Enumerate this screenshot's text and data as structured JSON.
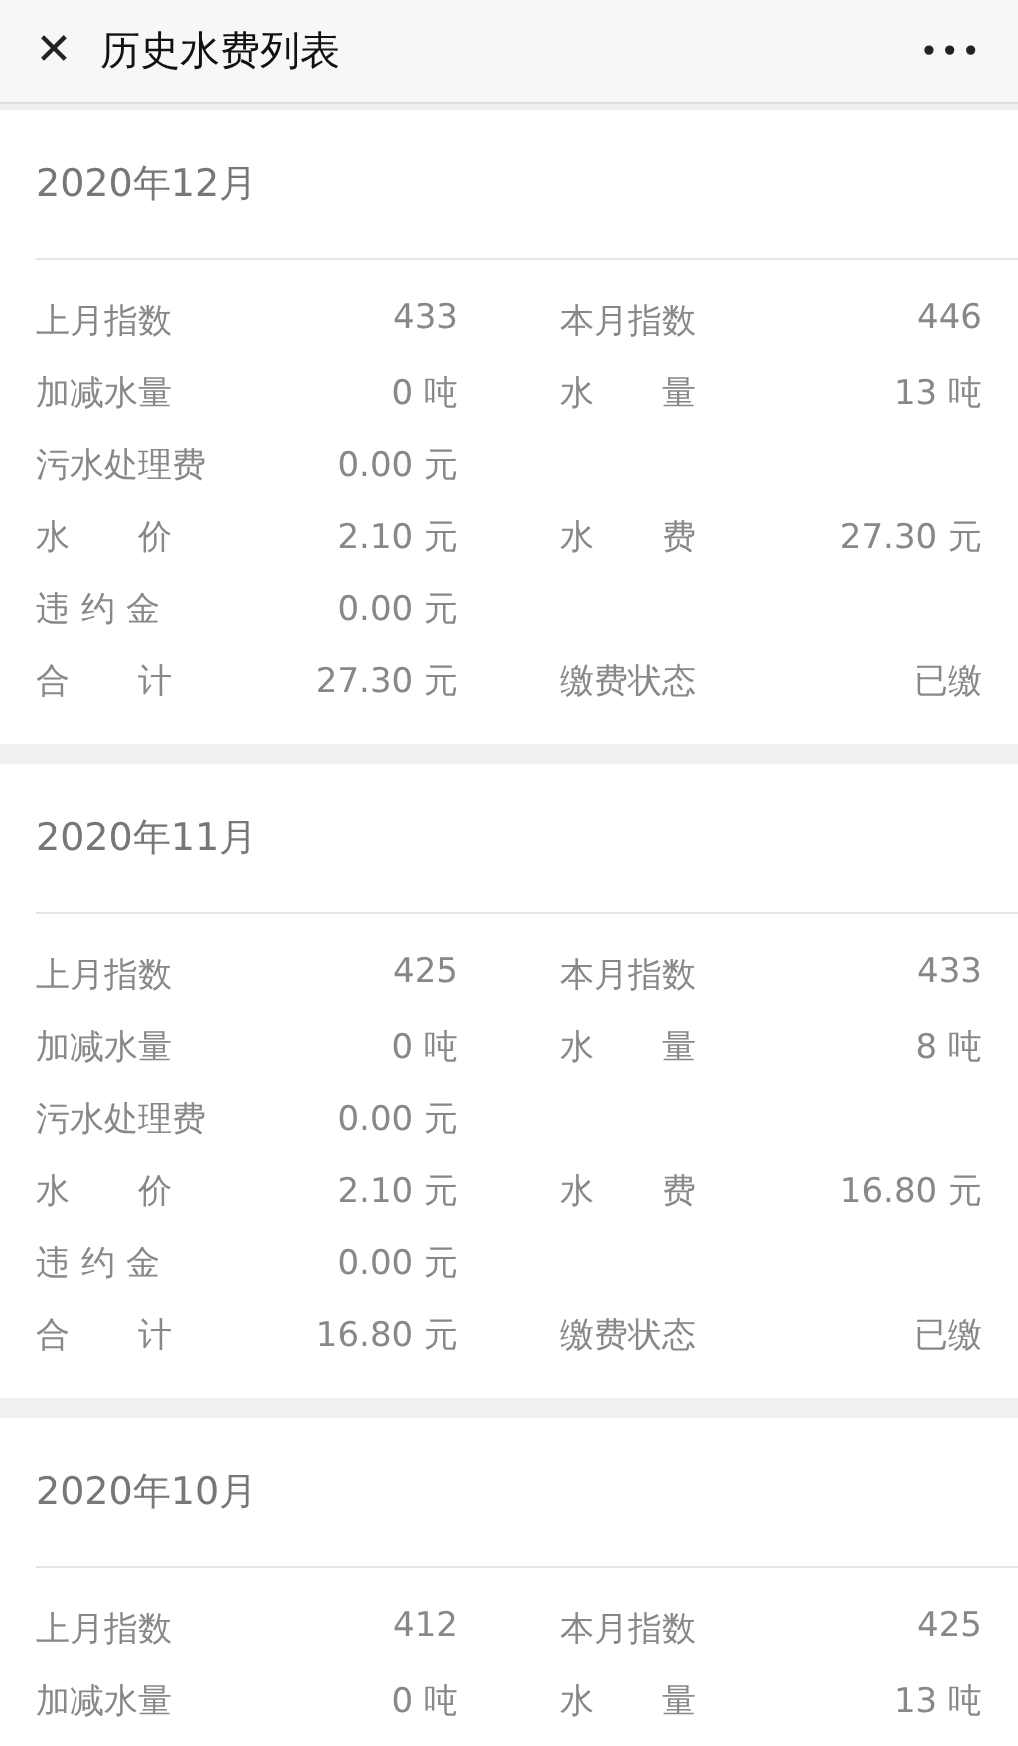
{
  "header": {
    "close": "✕",
    "title": "历史水费列表",
    "more": "•••"
  },
  "bills": [
    {
      "month": "2020年12月",
      "rows": [
        {
          "left": {
            "label": "上月指数",
            "value": "433"
          },
          "right": {
            "label": "本月指数",
            "value": "446"
          }
        },
        {
          "left": {
            "label": "加减水量",
            "value": "0 吨"
          },
          "right": {
            "label": "水　　量",
            "value": "13 吨"
          }
        },
        {
          "left": {
            "label": "污水处理费",
            "value": "0.00 元"
          }
        },
        {
          "left": {
            "label": "水　　价",
            "value": "2.10 元"
          },
          "right": {
            "label": "水　　费",
            "value": "27.30 元"
          }
        },
        {
          "left": {
            "label": "违 约 金",
            "value": "0.00 元"
          }
        },
        {
          "left": {
            "label": "合　　计",
            "value": "27.30 元"
          },
          "right": {
            "label": "缴费状态",
            "value": "已缴"
          }
        }
      ]
    },
    {
      "month": "2020年11月",
      "rows": [
        {
          "left": {
            "label": "上月指数",
            "value": "425"
          },
          "right": {
            "label": "本月指数",
            "value": "433"
          }
        },
        {
          "left": {
            "label": "加减水量",
            "value": "0 吨"
          },
          "right": {
            "label": "水　　量",
            "value": "8 吨"
          }
        },
        {
          "left": {
            "label": "污水处理费",
            "value": "0.00 元"
          }
        },
        {
          "left": {
            "label": "水　　价",
            "value": "2.10 元"
          },
          "right": {
            "label": "水　　费",
            "value": "16.80 元"
          }
        },
        {
          "left": {
            "label": "违 约 金",
            "value": "0.00 元"
          }
        },
        {
          "left": {
            "label": "合　　计",
            "value": "16.80 元"
          },
          "right": {
            "label": "缴费状态",
            "value": "已缴"
          }
        }
      ]
    },
    {
      "month": "2020年10月",
      "rows": [
        {
          "left": {
            "label": "上月指数",
            "value": "412"
          },
          "right": {
            "label": "本月指数",
            "value": "425"
          }
        },
        {
          "left": {
            "label": "加减水量",
            "value": "0 吨"
          },
          "right": {
            "label": "水　　量",
            "value": "13 吨"
          }
        }
      ]
    }
  ]
}
